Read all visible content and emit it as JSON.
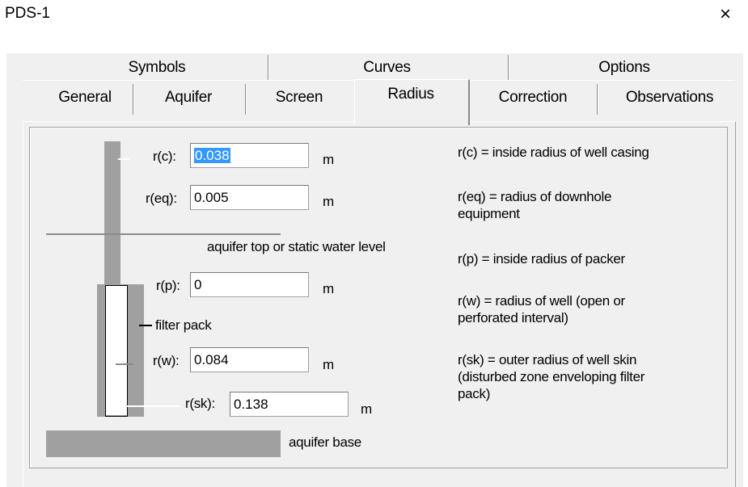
{
  "window": {
    "title": "PDS-1",
    "close_glyph": "×"
  },
  "tabs_row1": [
    {
      "label": "Symbols"
    },
    {
      "label": "Curves"
    },
    {
      "label": "Options"
    }
  ],
  "tabs_row2": [
    {
      "label": "General"
    },
    {
      "label": "Aquifer"
    },
    {
      "label": "Screen"
    },
    {
      "label": "Radius",
      "active": true
    },
    {
      "label": "Correction"
    },
    {
      "label": "Observations"
    }
  ],
  "fields": {
    "rc": {
      "label": "r(c):",
      "value": "0.038",
      "unit": "m"
    },
    "req": {
      "label": "r(eq):",
      "value": "0.005",
      "unit": "m"
    },
    "rp": {
      "label": "r(p):",
      "value": "0",
      "unit": "m"
    },
    "rw": {
      "label": "r(w):",
      "value": "0.084",
      "unit": "m"
    },
    "rsk": {
      "label": "r(sk):",
      "value": "0.138",
      "unit": "m"
    }
  },
  "diagram": {
    "aquifer_top": "aquifer top or static water level",
    "filter_pack": "filter pack",
    "aquifer_base": "aquifer base"
  },
  "descriptions": {
    "rc": "r(c) = inside radius of well casing",
    "req_1": "r(eq) = radius of downhole",
    "req_2": "equipment",
    "rp": "r(p) = inside radius of packer",
    "rw_1": "r(w) = radius of well (open or",
    "rw_2": "perforated interval)",
    "rsk_1": "r(sk) = outer radius of well skin",
    "rsk_2": "(disturbed zone enveloping filter",
    "rsk_3": "pack)"
  },
  "colors": {
    "selection": "#3399ff",
    "dialog_bg": "#f0f0f0",
    "diagram_gray": "#a0a0a0"
  }
}
